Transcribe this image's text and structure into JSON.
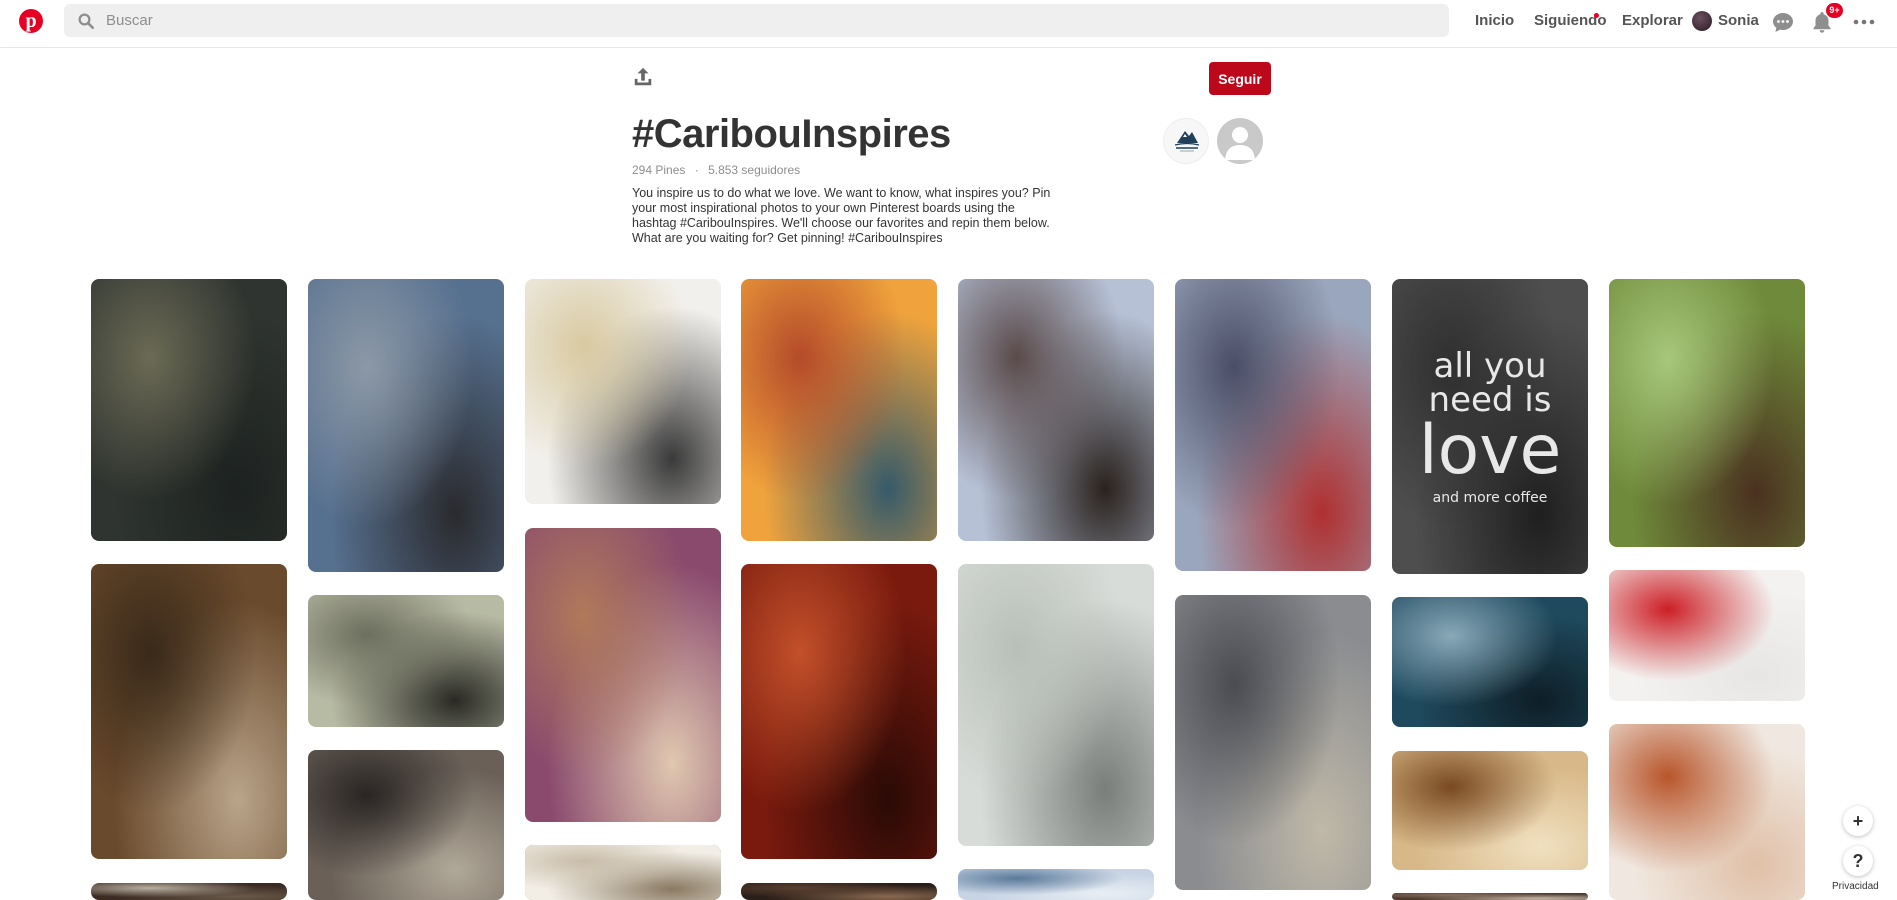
{
  "header": {
    "logo": "pinterest-logo",
    "search_placeholder": "Buscar",
    "nav": {
      "home": "Inicio",
      "following": "Siguiendo",
      "explore": "Explorar",
      "user": "Sonia"
    },
    "notifications_badge": "9+",
    "brand_color": "#e60023"
  },
  "board": {
    "title": "#CaribouInspires",
    "pins_count": "294 Pines",
    "separator": "·",
    "followers": "5.853 seguidores",
    "description": "You inspire us to do what we love. We want to know, what inspires you? Pin your most inspirational photos to your own Pinterest boards using the hashtag #CaribouInspires. We'll choose our favorites and repin them below. What are you waiting for? Get pinning! #CaribouInspires",
    "follow_label": "Seguir",
    "owner_logo_text": "Caribou",
    "follow_color": "#bd081c"
  },
  "pins": [
    {
      "subject": "children-on-old-car",
      "colors": [
        "#2f3430",
        "#6b6a55",
        "#1d2220"
      ]
    },
    {
      "subject": "sunset-clouds-sky",
      "colors": [
        "#56708f",
        "#8c98a6",
        "#2a2a2e"
      ]
    },
    {
      "subject": "kitchen-shelf-jars",
      "colors": [
        "#f2f0ec",
        "#d8c9a0",
        "#3a3a3a"
      ]
    },
    {
      "subject": "sunset-picnic",
      "colors": [
        "#f0a33c",
        "#b44a2a",
        "#355a6a"
      ]
    },
    {
      "subject": "canyon-dusk",
      "colors": [
        "#b6c1d6",
        "#5a4a4a",
        "#2a221e"
      ]
    },
    {
      "subject": "paintbrushes-hand",
      "colors": [
        "#9aa6bd",
        "#4a4e66",
        "#b03030"
      ]
    },
    {
      "subject": "all-you-need-is-love-chalkboard",
      "colors": [
        "#4e4e4e",
        "#2f2f2f",
        "#1f1f1f"
      ],
      "text_lines": [
        "all you",
        "need is",
        "love",
        "and more coffee"
      ]
    },
    {
      "subject": "park-classic-cars",
      "colors": [
        "#6f8a3a",
        "#a7c77a",
        "#4a3020"
      ]
    },
    {
      "subject": "vintage-scissors-box",
      "colors": [
        "#6a4a2c",
        "#3a2a1a",
        "#b9a48a"
      ]
    },
    {
      "subject": "vintage-bicycle",
      "colors": [
        "#b8bba4",
        "#6c6e5e",
        "#2a2a24"
      ]
    },
    {
      "subject": "stack-of-old-books",
      "colors": [
        "#8a4a6e",
        "#b07a5a",
        "#e0c8b0"
      ]
    },
    {
      "subject": "violin-closeup",
      "colors": [
        "#7a1a0e",
        "#c2502a",
        "#2a0a06"
      ]
    },
    {
      "subject": "baby-breath-vases",
      "colors": [
        "#d8dcd8",
        "#b8bfb8",
        "#7a7e7a"
      ]
    },
    {
      "subject": "vinyl-records-shelf",
      "colors": [
        "#8a8c90",
        "#4a4c52",
        "#c0b9a8"
      ]
    },
    {
      "subject": "turntable-record",
      "colors": [
        "#1f4a5e",
        "#88a8b8",
        "#0e1e26"
      ]
    },
    {
      "subject": "red-popsicle",
      "colors": [
        "#f4f2f0",
        "#cc1f26",
        "#e8e6e4"
      ]
    },
    {
      "subject": "leather-notebook",
      "colors": [
        "#6a6058",
        "#2a2624",
        "#b0a898"
      ]
    },
    {
      "subject": "red-bananas",
      "colors": [
        "#3a7a2a",
        "#b5202a",
        "#1e4a1a"
      ]
    },
    {
      "subject": "soup-bowl",
      "colors": [
        "#f0e8e0",
        "#b8552a",
        "#e0c0a8"
      ]
    },
    {
      "subject": "steaming-coffee",
      "colors": [
        "#d8b888",
        "#7a4a22",
        "#f0e0c0"
      ]
    },
    {
      "subject": "partial-pin",
      "colors": [
        "#3a2a22",
        "#b8b0a0",
        "#6a5a4a"
      ]
    },
    {
      "subject": "partial-pin-dark",
      "colors": [
        "#2a1e18",
        "#5a4030",
        "#8a6a50"
      ]
    },
    {
      "subject": "partial-pin-sky",
      "colors": [
        "#c8d4e4",
        "#5a7a9a",
        "#e8eef4"
      ]
    },
    {
      "subject": "partial-pin-brown",
      "colors": [
        "#4a3a30",
        "#8a7060",
        "#c8b8a8"
      ]
    },
    {
      "subject": "partial-pin-light",
      "colors": [
        "#f2eee6",
        "#c8bca8",
        "#8a7a62"
      ]
    }
  ],
  "floating": {
    "add_label": "+",
    "help_label": "?",
    "privacy_label": "Privacidad"
  }
}
